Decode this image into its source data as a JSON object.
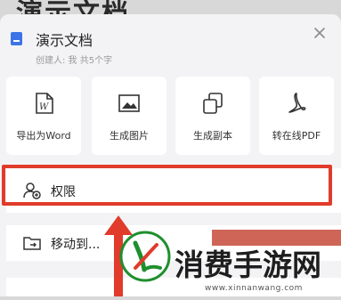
{
  "background": {
    "title_partial": "演示文档"
  },
  "sheet": {
    "title": "演示文档",
    "meta": "创建人: 我  共5个字",
    "close_icon": "close-icon"
  },
  "actions": [
    {
      "label": "导出为Word",
      "icon": "word-icon"
    },
    {
      "label": "生成图片",
      "icon": "image-icon"
    },
    {
      "label": "生成副本",
      "icon": "copy-icon"
    },
    {
      "label": "转在线PDF",
      "icon": "pdf-icon"
    }
  ],
  "menu": {
    "permission_label": "权限",
    "move_label": "移动到..."
  },
  "watermark": {
    "text": "消费手游网",
    "url": "www.xinnanwang.com"
  },
  "colors": {
    "highlight": "#e03b2b",
    "doc_icon": "#3b74e6",
    "logo_green": "#1f8f2e"
  }
}
